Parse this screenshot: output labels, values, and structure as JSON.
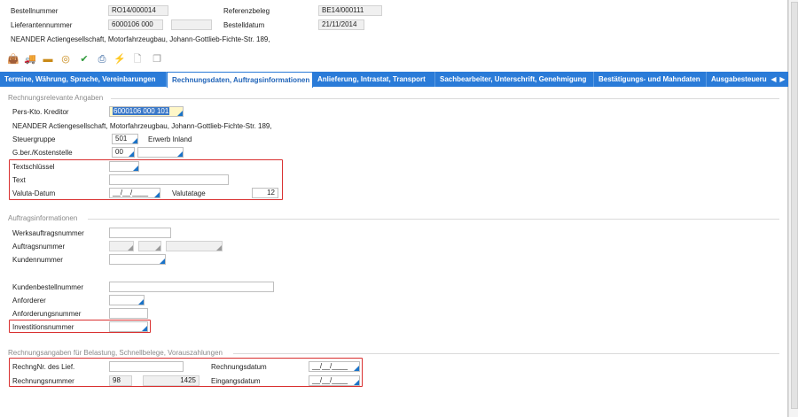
{
  "header": {
    "bestellnummer_label": "Bestellnummer",
    "bestellnummer_value": "RO14/000014",
    "referenzbeleg_label": "Referenzbeleg",
    "referenzbeleg_value": "BE14/000111",
    "lieferantennummer_label": "Lieferantennummer",
    "lieferantennummer_value": "6000106 000",
    "bestelldatum_label": "Bestelldatum",
    "bestelldatum_value": "21/11/2014",
    "supplier_address": "NEANDER Actiengesellschaft, Motorfahrzeugbau, Johann-Gottlieb-Fichte-Str. 189,"
  },
  "toolbar": {
    "icons": [
      "bag-icon",
      "truck-icon",
      "card-icon",
      "coins-icon",
      "check-icon",
      "print-icon",
      "lightning-icon",
      "document-icon",
      "package-icon"
    ]
  },
  "tabs": [
    {
      "label": "Termine, Währung, Sprache, Vereinbarungen"
    },
    {
      "label": "Rechnungsdaten, Auftragsinformationen"
    },
    {
      "label": "Anlieferung, Intrastat, Transport"
    },
    {
      "label": "Sachbearbeiter, Unterschrift, Genehmigung"
    },
    {
      "label": "Bestätigungs- und Mahndaten"
    },
    {
      "label": "Ausgabesteueru"
    }
  ],
  "sections": {
    "rechnung": {
      "title": "Rechnungsrelevante Angaben",
      "pers_kto_label": "Pers-Kto. Kreditor",
      "pers_kto_value": "6000106 000 101",
      "address": "NEANDER Actiengesellschaft, Motorfahrzeugbau, Johann-Gottlieb-Fichte-Str. 189,",
      "steuergruppe_label": "Steuergruppe",
      "steuergruppe_value": "501",
      "steuergruppe_desc": "Erwerb Inland",
      "gber_label": "G.ber./Kostenstelle",
      "gber_value": "00",
      "textschluessel_label": "Textschlüssel",
      "text_label": "Text",
      "valuta_datum_label": "Valuta-Datum",
      "valuta_datum_value": "__/__/____",
      "valutatage_label": "Valutatage",
      "valutatage_value": "12"
    },
    "auftrag": {
      "title": "Auftragsinformationen",
      "werksauftrag_label": "Werksauftragsnummer",
      "auftragsnummer_label": "Auftragsnummer",
      "kundennummer_label": "Kundennummer",
      "kundenbestell_label": "Kundenbestellnummer",
      "anforderer_label": "Anforderer",
      "anforderungs_label": "Anforderungsnummer",
      "investitions_label": "Investitionsnummer"
    },
    "belastung": {
      "title": "Rechnungsangaben für Belastung, Schnellbelege, Vorauszahlungen",
      "rechnr_label": "RechngNr. des Lief.",
      "rechnungsdatum_label": "Rechnungsdatum",
      "rechnungsdatum_value": "__/__/____",
      "rechnungsnummer_label": "Rechnungsnummer",
      "rechnungsnummer_prefix": "98",
      "rechnungsnummer_value": "1425",
      "eingangsdatum_label": "Eingangsdatum",
      "eingangsdatum_value": "__/__/____"
    }
  },
  "colors": {
    "tab_bar": "#2a7bd8",
    "highlight": "#d93030",
    "f4_marker": "#1a73c8"
  }
}
